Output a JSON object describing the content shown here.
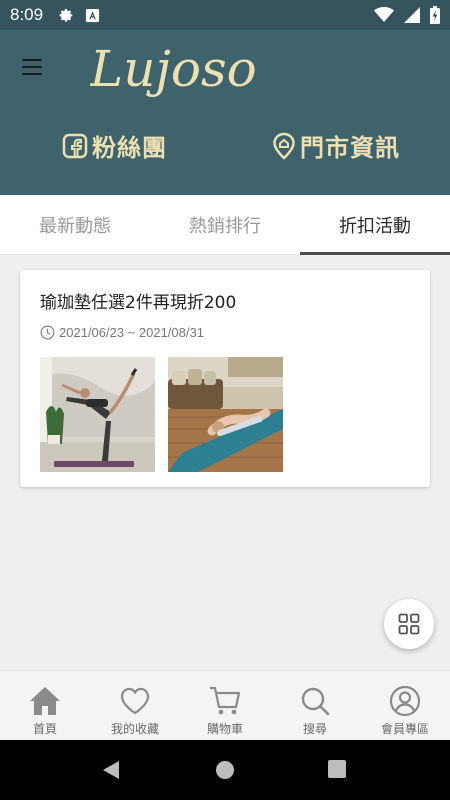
{
  "status_bar": {
    "time": "8:09"
  },
  "header": {
    "brand": "Lujoso",
    "fans_link_label": "粉絲團",
    "store_link_label": "門市資訊"
  },
  "tabs": [
    {
      "label": "最新動態",
      "active": false
    },
    {
      "label": "熱銷排行",
      "active": false
    },
    {
      "label": "折扣活動",
      "active": true
    }
  ],
  "promo": {
    "title": "瑜珈墊任選2件再現折200",
    "date_range": "2021/06/23 ~ 2021/08/31",
    "images": [
      "yoga-dancer-pose-photo",
      "yoga-forward-fold-photo"
    ]
  },
  "bottom_nav": [
    {
      "label": "首頁",
      "icon": "home-icon"
    },
    {
      "label": "我的收藏",
      "icon": "heart-icon"
    },
    {
      "label": "購物車",
      "icon": "cart-icon"
    },
    {
      "label": "搜尋",
      "icon": "search-icon"
    },
    {
      "label": "會員專區",
      "icon": "user-icon"
    }
  ],
  "colors": {
    "header_bg": "#3f636d",
    "status_bg": "#35545d",
    "accent_text": "#ecdfb1",
    "nav_icon": "#8a8a8a"
  }
}
